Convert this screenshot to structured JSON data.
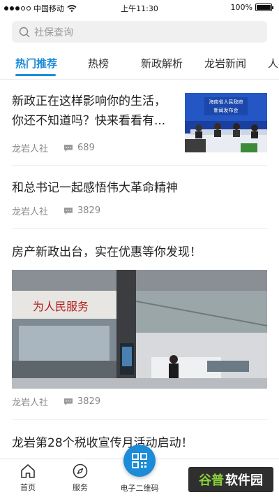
{
  "status_bar": {
    "carrier": "中国移动",
    "time": "上午11:30",
    "battery": "100%",
    "battery_level": 1.0,
    "signal_bars": 3
  },
  "search": {
    "placeholder": "社保查询"
  },
  "tabs": [
    {
      "label": "热门推荐",
      "active": true
    },
    {
      "label": "热榜"
    },
    {
      "label": "新政解析"
    },
    {
      "label": "龙岩新闻"
    },
    {
      "label": "人事"
    }
  ],
  "articles": [
    {
      "title_line1": "新政正在这样影响你的生活，",
      "title_line2": "你还不知道吗？快来看看有...",
      "source": "龙岩人社",
      "comments": "689",
      "image_text_top": "海南省人民政府",
      "image_text_bottom": "新闻发布会"
    },
    {
      "title": "和总书记一起感悟伟大革命精神",
      "source": "龙岩人社",
      "comments": "3829"
    },
    {
      "title": "房产新政出台，实在优惠等你发现！",
      "source": "龙岩人社",
      "comments": "3829",
      "image_sign": "为人民服务"
    },
    {
      "title": "龙岩第28个税收宣传月活动启动！"
    }
  ],
  "bottom_nav": {
    "home": "首页",
    "service": "服务",
    "qrcode": "电子二维码"
  },
  "watermark": {
    "part1": "谷普",
    "part2": "软件园"
  },
  "colors": {
    "accent": "#1c8bd8",
    "text": "#222222",
    "meta": "#888888"
  }
}
